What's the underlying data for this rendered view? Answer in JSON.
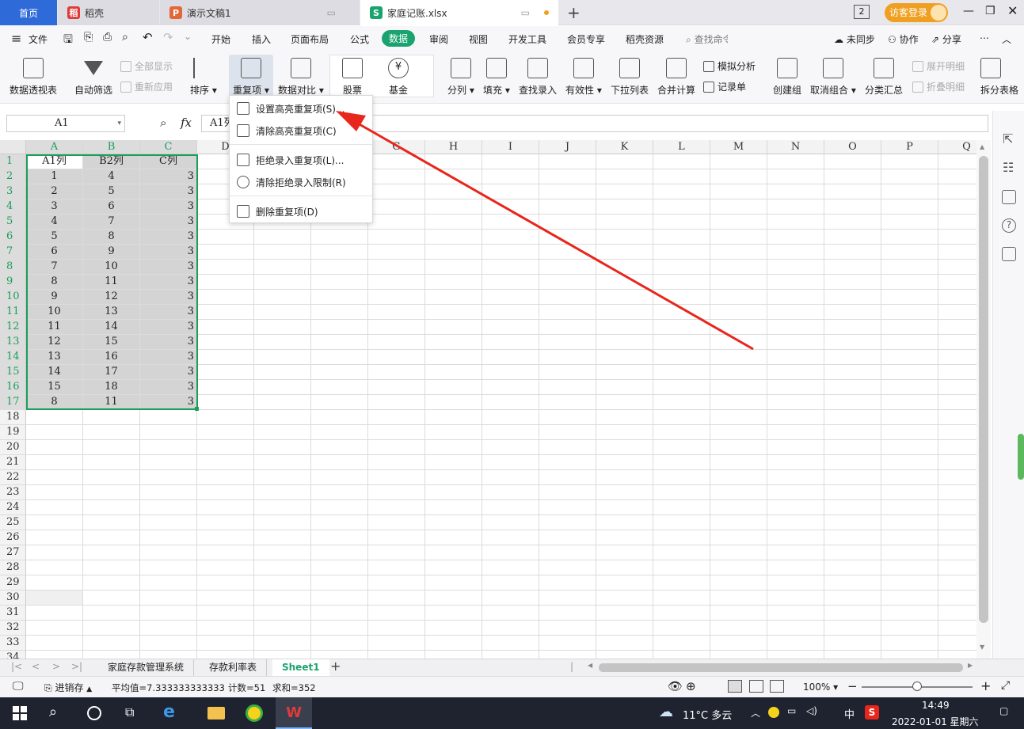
{
  "tabs": {
    "home": "首页",
    "daoke": "稻壳",
    "ppt": "演示文稿1",
    "xlsx": "家庭记账.xlsx",
    "count_badge": "2",
    "login": "访客登录"
  },
  "menu": {
    "file": "文件",
    "items": [
      "开始",
      "插入",
      "页面布局",
      "公式",
      "数据",
      "审阅",
      "视图",
      "开发工具",
      "会员专享",
      "稻壳资源"
    ],
    "search": "查找命令",
    "unsync": "未同步",
    "collab": "协作",
    "share": "分享"
  },
  "ribbon": {
    "pivot": "数据透视表",
    "filter": "自动筛选",
    "show_all": "全部显示",
    "reapply": "重新应用",
    "sort": "排序",
    "dup": "重复项",
    "compare": "数据对比",
    "stock": "股票",
    "fund": "基金",
    "split": "分列",
    "fill": "填充",
    "lookup": "查找录入",
    "validity": "有效性",
    "dropdown_list": "下拉列表",
    "consolidate": "合并计算",
    "simulate": "模拟分析",
    "record": "记录单",
    "create_group": "创建组",
    "ungroup": "取消组合",
    "subtotal": "分类汇总",
    "expand": "展开明细",
    "collapse": "折叠明细",
    "split_table": "拆分表格"
  },
  "formula": {
    "cellref": "A1",
    "fx": "fx",
    "content": "A1列"
  },
  "dropdown": {
    "set_highlight": "设置高亮重复项(S)...",
    "clear_highlight": "清除高亮重复项(C)",
    "reject_entry": "拒绝录入重复项(L)...",
    "clear_reject": "清除拒绝录入限制(R)",
    "delete_dup": "删除重复项(D)"
  },
  "columns": [
    "A",
    "B",
    "C",
    "D",
    "E",
    "F",
    "G",
    "H",
    "I",
    "J",
    "K",
    "L",
    "M",
    "N",
    "O",
    "P",
    "Q"
  ],
  "grid": {
    "header": [
      "A1列",
      "B2列",
      "C列"
    ],
    "rows": [
      [
        1,
        4,
        3
      ],
      [
        2,
        5,
        3
      ],
      [
        3,
        6,
        3
      ],
      [
        4,
        7,
        3
      ],
      [
        5,
        8,
        3
      ],
      [
        6,
        9,
        3
      ],
      [
        7,
        10,
        3
      ],
      [
        8,
        11,
        3
      ],
      [
        9,
        12,
        3
      ],
      [
        10,
        13,
        3
      ],
      [
        11,
        14,
        3
      ],
      [
        12,
        15,
        3
      ],
      [
        13,
        16,
        3
      ],
      [
        14,
        17,
        3
      ],
      [
        15,
        18,
        3
      ],
      [
        8,
        11,
        3
      ]
    ]
  },
  "sheettabs": [
    "家庭存款管理系统",
    "存款利率表",
    "Sheet1"
  ],
  "status": {
    "backup": "进销存",
    "avg": "平均值=7.333333333333",
    "count": "计数=51",
    "sum": "求和=352",
    "zoom": "100%"
  },
  "taskbar": {
    "weather": "11°C 多云",
    "ime": "中",
    "time": "14:49",
    "date": "2022-01-01 星期六"
  },
  "colors": {
    "accent": "#1aa36f",
    "arrow": "#e8261c",
    "selection": "#1a9e5a",
    "login": "#f0a020"
  }
}
